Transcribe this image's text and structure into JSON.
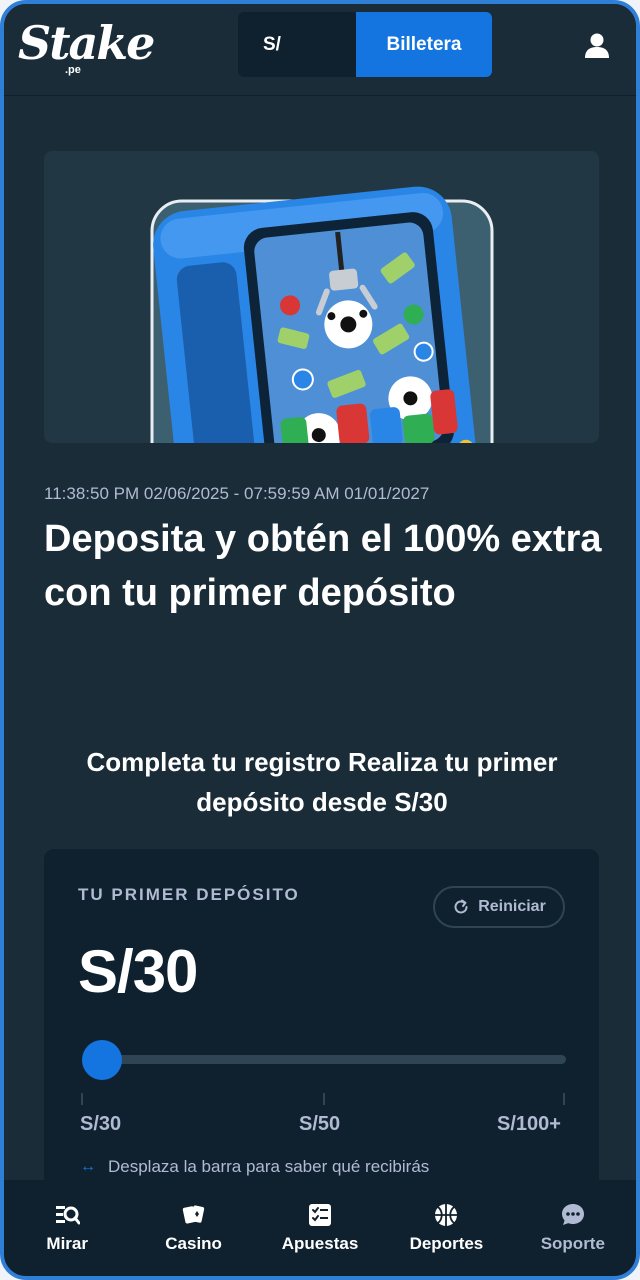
{
  "header": {
    "logo_text": "Stake",
    "logo_domain": ".pe",
    "wallet_balance": "S/",
    "wallet_button": "Billetera",
    "user_icon": "user-icon"
  },
  "banner": {
    "illustration": "claw-machine-with-soccer-balls-and-chips"
  },
  "promo": {
    "date_range": "11:38:50 PM 02/06/2025 - 07:59:59 AM 01/01/2027",
    "title": "Deposita y obtén el 100% extra con tu primer depósito",
    "subtitle": "Completa tu registro Realiza tu primer depósito desde S/30"
  },
  "deposit_card": {
    "label": "TU PRIMER DEPÓSITO",
    "reset_label": "Reiniciar",
    "amount": "S/30",
    "slider_value_fraction": 0.0,
    "ticks": [
      "S/30",
      "S/50",
      "S/100+"
    ],
    "hint": "Desplaza la barra para saber qué recibirás"
  },
  "bottom_nav": {
    "items": [
      {
        "label": "Mirar",
        "icon": "browse-icon"
      },
      {
        "label": "Casino",
        "icon": "cards-icon"
      },
      {
        "label": "Apuestas",
        "icon": "betslip-icon"
      },
      {
        "label": "Deportes",
        "icon": "basketball-icon"
      },
      {
        "label": "Soporte",
        "icon": "chat-icon"
      }
    ]
  },
  "colors": {
    "background": "#1a2c38",
    "card": "#0f212e",
    "accent": "#1475e1",
    "muted_text": "#b1bad3"
  }
}
